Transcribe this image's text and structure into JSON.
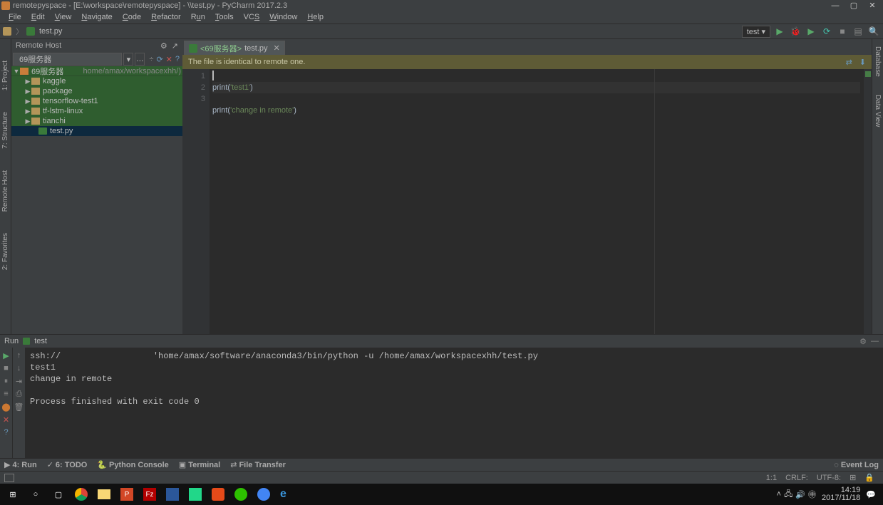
{
  "titlebar": {
    "text": "remotepyspace - [E:\\workspace\\remotepyspace] - \\\\test.py - PyCharm 2017.2.3"
  },
  "menu": [
    "File",
    "Edit",
    "View",
    "Navigate",
    "Code",
    "Refactor",
    "Run",
    "Tools",
    "VCS",
    "Window",
    "Help"
  ],
  "breadcrumb": {
    "file": "test.py"
  },
  "toolbar": {
    "run_config": "test ▾",
    "icons": {
      "run": "▶",
      "debug": "🐞",
      "coverage": "▶",
      "stop": "■",
      "layout": "▤",
      "search": "🔍"
    }
  },
  "sidepanel": {
    "title": "Remote Host",
    "gear": "⚙",
    "out": "↗",
    "server": "69服务器",
    "sel_icons": {
      "divide": "÷",
      "refresh": "⟳",
      "close": "✕",
      "help": "?"
    },
    "root": {
      "label": "69服务器",
      "path": "home/amax/workspacexhh/)"
    },
    "items": [
      {
        "label": "kaggle",
        "type": "folder"
      },
      {
        "label": "package",
        "type": "folder"
      },
      {
        "label": "tensorflow-test1",
        "type": "folder"
      },
      {
        "label": "tf-lstm-linux",
        "type": "folder"
      },
      {
        "label": "tianchi",
        "type": "folder"
      },
      {
        "label": "test.py",
        "type": "file",
        "sel": true
      }
    ]
  },
  "leftbar": {
    "a": "1: Project",
    "b": "7: Structure",
    "c": "Remote Host",
    "d": "2: Favorites"
  },
  "rightbar": {
    "a": "Database",
    "b": "Data View"
  },
  "tab": {
    "prefix": "<69服务器>",
    "name": "test.py"
  },
  "infobar": {
    "msg": "The file is identical to remote one."
  },
  "editor": {
    "lines": [
      "1",
      "2",
      "3"
    ],
    "l1a": "print(",
    "l1b": "'test1'",
    "l1c": ")",
    "l2a": "print(",
    "l2b": "'change in remote'",
    "l2c": ")"
  },
  "run": {
    "label": "Run",
    "cfg": "test",
    "lbar1": {
      "play": "▶",
      "up": "↑",
      "stop": "■",
      "pause": "⏸",
      "x": "✕"
    },
    "lbar2": {
      "a": "⇥",
      "b": "📋",
      "c": "⎙",
      "d": "🗑"
    },
    "out": "ssh://                  'home/amax/software/anaconda3/bin/python -u /home/amax/workspacexhh/test.py\ntest1\nchange in remote\n\nProcess finished with exit code 0\n"
  },
  "btm": {
    "run": "4: Run",
    "todo": "6: TODO",
    "pyc": "Python Console",
    "term": "Terminal",
    "ft": "File Transfer",
    "evlog": "Event Log"
  },
  "status": {
    "pos": "1:1",
    "sep": "CRLF:",
    "enc": "UTF-8:",
    "ctx": "⊞",
    "lock": "🔒"
  },
  "taskbar": {
    "win": "⊞",
    "search": "○",
    "tasks": "▢",
    "apps": [
      "chrome",
      "files",
      "ppt",
      "fz",
      "img",
      "pyc",
      "orange",
      "we",
      "cloud",
      "edge"
    ],
    "time": "14:19",
    "date": "2017/11/18"
  }
}
